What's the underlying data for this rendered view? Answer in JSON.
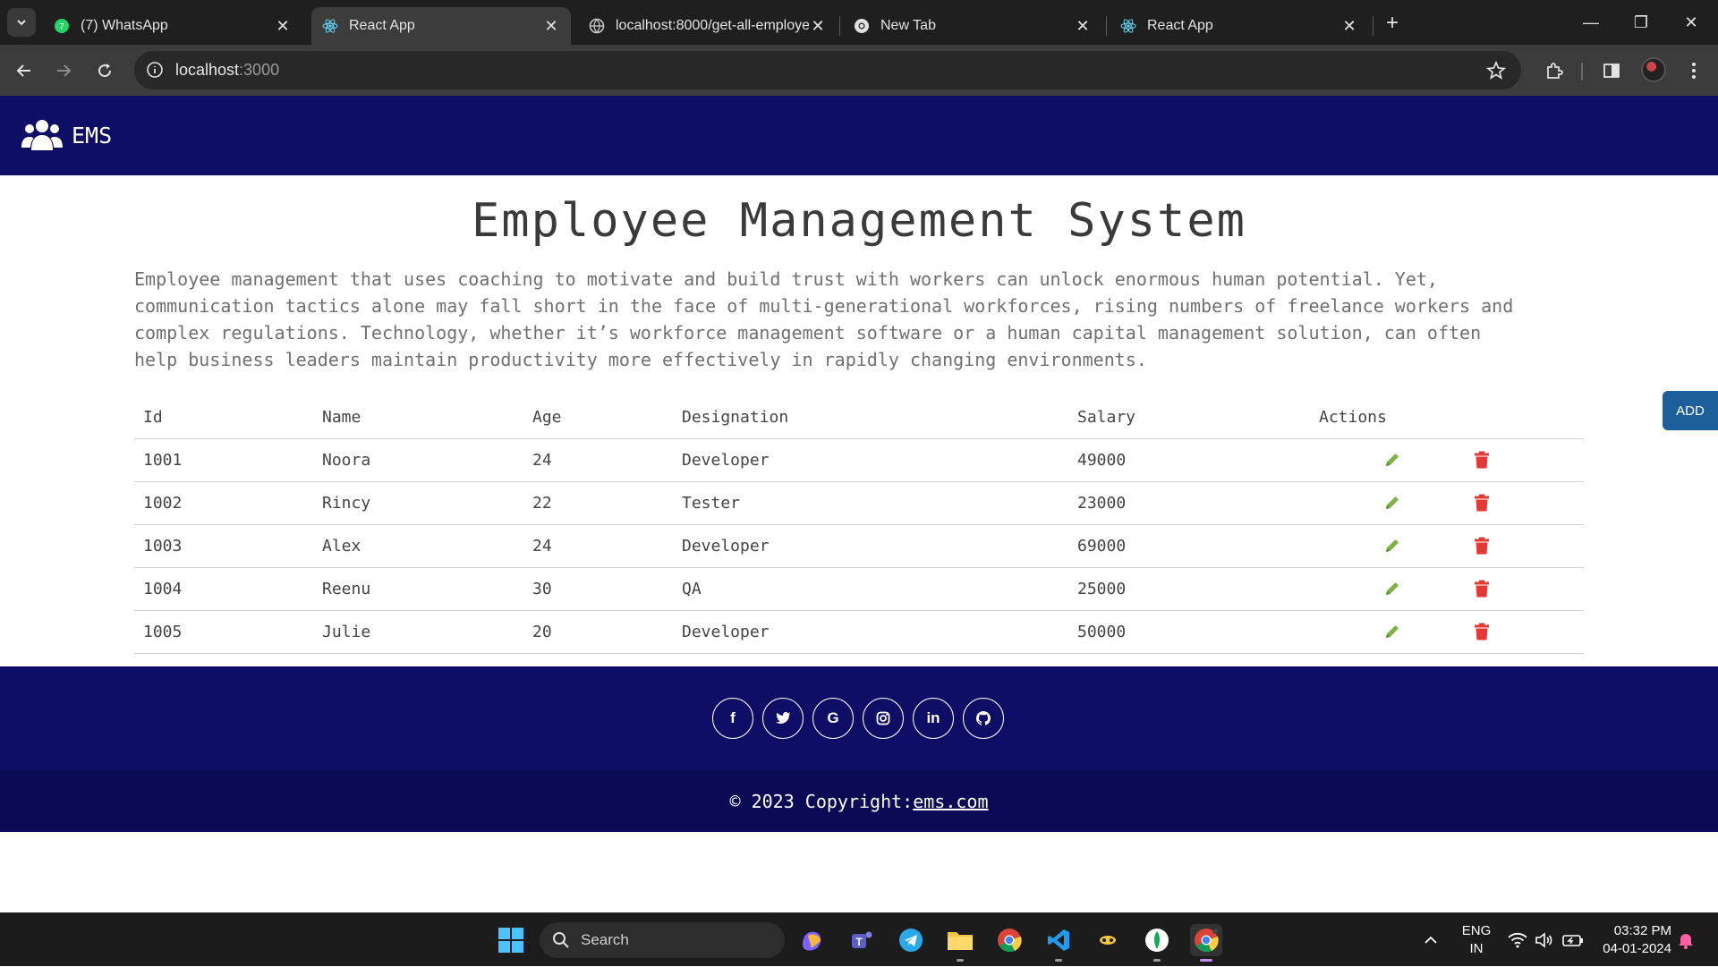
{
  "browser": {
    "tabs": [
      {
        "title": "(7) WhatsApp",
        "icon": "whatsapp-icon",
        "active": false
      },
      {
        "title": "React App",
        "icon": "react-icon",
        "active": true
      },
      {
        "title": "localhost:8000/get-all-employe",
        "icon": "globe-icon",
        "active": false
      },
      {
        "title": "New Tab",
        "icon": "chrome-icon",
        "active": false
      },
      {
        "title": "React App",
        "icon": "react-icon",
        "active": false
      }
    ],
    "url_host": "localhost",
    "url_port": ":3000"
  },
  "app": {
    "brand": "EMS",
    "title": "Employee Management System",
    "intro": "Employee management that uses coaching to motivate and build trust with workers can unlock enormous human potential. Yet, communication tactics alone may fall short in the face of multi-generational workforces, rising numbers of freelance workers and complex regulations. Technology, whether it’s workforce management software or a human capital management solution, can often help business leaders maintain productivity more effectively in rapidly changing environments.",
    "add_label": "ADD",
    "table": {
      "headers": [
        "Id",
        "Name",
        "Age",
        "Designation",
        "Salary",
        "Actions"
      ],
      "rows": [
        [
          "1001",
          "Noora",
          "24",
          "Developer",
          "49000"
        ],
        [
          "1002",
          "Rincy",
          "22",
          "Tester",
          "23000"
        ],
        [
          "1003",
          "Alex",
          "24",
          "Developer",
          "69000"
        ],
        [
          "1004",
          "Reenu",
          "30",
          "QA",
          "25000"
        ],
        [
          "1005",
          "Julie",
          "20",
          "Developer",
          "50000"
        ]
      ]
    },
    "footer": {
      "socials": [
        "facebook-icon",
        "twitter-icon",
        "google-icon",
        "instagram-icon",
        "linkedin-icon",
        "github-icon"
      ],
      "copyright_prefix": "© 2023 Copyright:",
      "copyright_link": "ems.com"
    }
  },
  "taskbar": {
    "search_label": "Search",
    "lang_top": "ENG",
    "lang_bottom": "IN",
    "time": "03:32 PM",
    "date": "04-01-2024"
  },
  "colors": {
    "navbar": "#0e0e66",
    "edit_icon": "#7cb342",
    "delete_icon": "#e53935",
    "add_button": "#1d5f9a"
  }
}
